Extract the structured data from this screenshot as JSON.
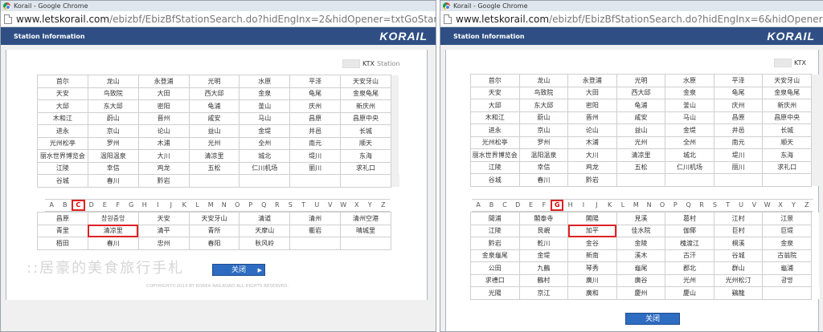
{
  "left": {
    "title": "Korail - Google Chrome",
    "url_host": "www.letskorail.com",
    "url_rest": "/ebizbf/EbizBfStationSearch.do?hidEngInx=2&hidOpener=txtGoStart",
    "header_title": "Station Information",
    "logo": "KORAIL",
    "legend_label": "KTX",
    "legend_station": "Station",
    "major": [
      [
        "首尔",
        "龙山",
        "永登浦",
        "光明",
        "水原",
        "平泽",
        "天安牙山"
      ],
      [
        "天安",
        "鸟致院",
        "大田",
        "西大邱",
        "金泉",
        "龟尾",
        "金泉龟尾"
      ],
      [
        "大邱",
        "东大邱",
        "密阳",
        "龟浦",
        "釜山",
        "庆州",
        "新庆州"
      ],
      [
        "木和江",
        "蔚山",
        "晋州",
        "咸安",
        "马山",
        "昌原",
        "昌原中央"
      ],
      [
        "进永",
        "京山",
        "论山",
        "益山",
        "金堤",
        "井邑",
        "长城"
      ],
      [
        "光州松亭",
        "罗州",
        "木浦",
        "光州",
        "全州",
        "南元",
        "顺天"
      ],
      [
        "丽水世界博览会",
        "温阳温泉",
        "大川",
        "清凉里",
        "城北",
        "堤川",
        "东海"
      ],
      [
        "江陵",
        "幸信",
        "鸡龙",
        "五松",
        "仁川机场",
        "丽川",
        "求礼口"
      ],
      [
        "谷城",
        "春川",
        "黔岩",
        "",
        "",
        "",
        ""
      ]
    ],
    "letters": [
      "A",
      "B",
      "C",
      "D",
      "E",
      "F",
      "G",
      "H",
      "I",
      "J",
      "K",
      "L",
      "M",
      "N",
      "O",
      "P",
      "Q",
      "R",
      "S",
      "T",
      "U",
      "V",
      "W",
      "X",
      "Y",
      "Z"
    ],
    "selected_letter": "C",
    "results": [
      [
        "昌原",
        "창원중앙",
        "天安",
        "天安牙山",
        "清道",
        "清州",
        "清州空港"
      ],
      [
        "青里",
        "清凉里",
        "清平",
        "青所",
        "天摩山",
        "衢岩",
        "晴城里"
      ],
      [
        "栢田",
        "春川",
        "忠州",
        "春阳",
        "秋风岭",
        "",
        ""
      ]
    ],
    "close_label": "关闭",
    "watermark": "::居豪的美食旅行手札",
    "copyright": "COPYRIGHT©2013 BY KOREA RAILROAD ALL RIGHTS RESERVED."
  },
  "right": {
    "title": "Korail - Google Chrome",
    "url_host": "www.letskorail.com",
    "url_rest": "/ebizbf/EbizBfStationSearch.do?hidEngInx=6&hidOpener=txtGoStart",
    "header_title": "Station Information",
    "logo": "KORAIL",
    "legend_label": "KTX",
    "legend_station": "Station",
    "major": [
      [
        "首尔",
        "龙山",
        "永登浦",
        "光明",
        "水原",
        "平泽",
        "天安牙山"
      ],
      [
        "天安",
        "鸟致院",
        "大田",
        "西大邱",
        "金泉",
        "龟尾",
        "金泉龟尾"
      ],
      [
        "大邱",
        "东大邱",
        "密阳",
        "龟浦",
        "釜山",
        "庆州",
        "新庆州"
      ],
      [
        "木和江",
        "蔚山",
        "晋州",
        "咸安",
        "马山",
        "昌原",
        "昌原中央"
      ],
      [
        "进永",
        "京山",
        "论山",
        "益山",
        "金堤",
        "井邑",
        "长城"
      ],
      [
        "光州松亭",
        "罗州",
        "木浦",
        "光州",
        "全州",
        "南元",
        "顺天"
      ],
      [
        "丽水世界博览会",
        "温阳温泉",
        "大川",
        "清凉里",
        "城北",
        "堤川",
        "东海"
      ],
      [
        "江陵",
        "幸信",
        "鸡龙",
        "五松",
        "仁川机场",
        "丽川",
        "求礼口"
      ],
      [
        "谷城",
        "春川",
        "黔岩",
        "",
        "",
        "",
        ""
      ]
    ],
    "letters": [
      "A",
      "B",
      "C",
      "D",
      "E",
      "F",
      "G",
      "H",
      "I",
      "J",
      "K",
      "L",
      "M",
      "N",
      "O",
      "P",
      "Q",
      "R",
      "S",
      "T",
      "U",
      "V",
      "W",
      "X",
      "Y",
      "Z"
    ],
    "selected_letter": "G",
    "results": [
      [
        "間浦",
        "閣泰寺",
        "閣陽",
        "見溪",
        "葛村",
        "江村",
        "江景"
      ],
      [
        "江陵",
        "艮峴",
        "加平",
        "佳水院",
        "伽倻",
        "巨村",
        "巨堤"
      ],
      [
        "黔岩",
        "乾川",
        "金谷",
        "金陵",
        "槐渡江",
        "桐溪",
        "金泉"
      ],
      [
        "金泉龜尾",
        "金堤",
        "新南",
        "溪木",
        "古汗",
        "谷城",
        "古翁院"
      ],
      [
        "公田",
        "九鶴",
        "琴秀",
        "龜尾",
        "郡北",
        "群山",
        "龜浦"
      ],
      [
        "求禮口",
        "鶴村",
        "廣川",
        "廣谷",
        "光州",
        "光州松汀",
        "광명"
      ],
      [
        "光陽",
        "京江",
        "廣和",
        "慶州",
        "慶山",
        "鷄龍",
        ""
      ]
    ],
    "close_label": "关闭"
  }
}
